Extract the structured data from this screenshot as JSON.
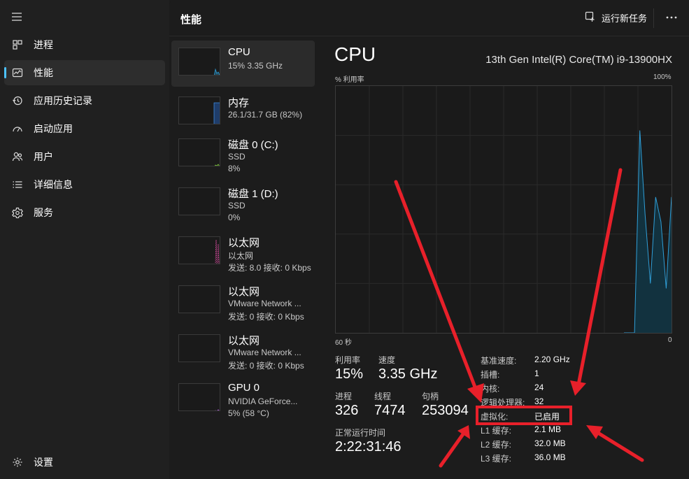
{
  "sidebar": {
    "items": [
      {
        "label": "进程",
        "icon": "processes-icon"
      },
      {
        "label": "性能",
        "icon": "performance-icon"
      },
      {
        "label": "应用历史记录",
        "icon": "history-icon"
      },
      {
        "label": "启动应用",
        "icon": "startup-icon"
      },
      {
        "label": "用户",
        "icon": "users-icon"
      },
      {
        "label": "详细信息",
        "icon": "details-icon"
      },
      {
        "label": "服务",
        "icon": "services-icon"
      }
    ],
    "settings": "设置"
  },
  "header": {
    "title": "性能",
    "run_task": "运行新任务"
  },
  "resources": [
    {
      "name": "CPU",
      "sub1": "15% 3.35 GHz",
      "sub2": ""
    },
    {
      "name": "内存",
      "sub1": "26.1/31.7 GB (82%)",
      "sub2": ""
    },
    {
      "name": "磁盘 0 (C:)",
      "sub1": "SSD",
      "sub2": "8%"
    },
    {
      "name": "磁盘 1 (D:)",
      "sub1": "SSD",
      "sub2": "0%"
    },
    {
      "name": "以太网",
      "sub1": "以太网",
      "sub2": "发送: 8.0 接收: 0 Kbps"
    },
    {
      "name": "以太网",
      "sub1": "VMware Network ...",
      "sub2": "发送: 0 接收: 0 Kbps"
    },
    {
      "name": "以太网",
      "sub1": "VMware Network ...",
      "sub2": "发送: 0 接收: 0 Kbps"
    },
    {
      "name": "GPU 0",
      "sub1": "NVIDIA GeForce...",
      "sub2": "5% (58 °C)"
    }
  ],
  "detail": {
    "title": "CPU",
    "model": "13th Gen Intel(R) Core(TM) i9-13900HX",
    "y_label": "% 利用率",
    "y_max": "100%",
    "x_left": "60 秒",
    "x_right": "0",
    "utilization_label": "利用率",
    "utilization": "15%",
    "speed_label": "速度",
    "speed": "3.35 GHz",
    "processes_label": "进程",
    "processes": "326",
    "threads_label": "线程",
    "threads": "7474",
    "handles_label": "句柄",
    "handles": "253094",
    "uptime_label": "正常运行时间",
    "uptime": "2:22:31:46"
  },
  "specs": [
    {
      "key": "基准速度:",
      "value": "2.20 GHz"
    },
    {
      "key": "插槽:",
      "value": "1"
    },
    {
      "key": "内核:",
      "value": "24"
    },
    {
      "key": "逻辑处理器:",
      "value": "32"
    },
    {
      "key": "虚拟化:",
      "value": "已启用"
    },
    {
      "key": "L1 缓存:",
      "value": "2.1 MB"
    },
    {
      "key": "L2 缓存:",
      "value": "32.0 MB"
    },
    {
      "key": "L3 缓存:",
      "value": "36.0 MB"
    }
  ],
  "chart_data": {
    "type": "area",
    "x": [
      0,
      1,
      2,
      3,
      4,
      5,
      6,
      7,
      8,
      9
    ],
    "values": [
      0,
      0,
      0,
      82,
      48,
      20,
      55,
      45,
      18,
      55
    ],
    "ylim": [
      0,
      100
    ]
  },
  "colors": {
    "accent": "#4cc2ff",
    "cpu_line": "#2f9fd8",
    "annotation": "#e8202a"
  }
}
